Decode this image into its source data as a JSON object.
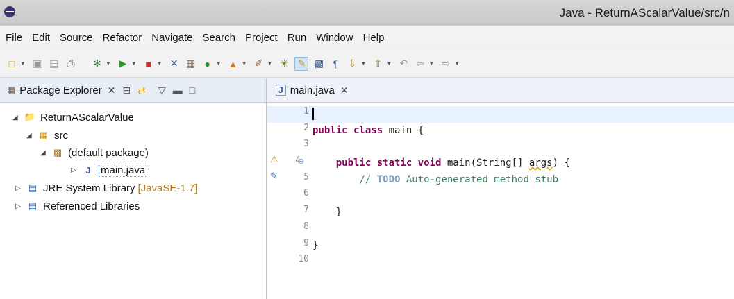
{
  "window": {
    "title": "Java - ReturnAScalarValue/src/n"
  },
  "menu": [
    "File",
    "Edit",
    "Source",
    "Refactor",
    "Navigate",
    "Search",
    "Project",
    "Run",
    "Window",
    "Help"
  ],
  "package_explorer": {
    "tab_label": "Package Explorer",
    "tree": {
      "project": "ReturnAScalarValue",
      "src": "src",
      "package": "(default package)",
      "file": "main.java",
      "jre_label": "JRE System Library",
      "jre_version": "[JavaSE-1.7]",
      "ref_libs": "Referenced Libraries"
    }
  },
  "editor": {
    "tab_label": "main.java",
    "line_numbers": [
      "1",
      "2",
      "3",
      "4",
      "5",
      "6",
      "7",
      "8",
      "9",
      "10"
    ],
    "code": {
      "l2_kw": "public class",
      "l2_rest": " main {",
      "l4_kw": "public static void",
      "l4_method": " main(String[] ",
      "l4_args": "args",
      "l4_end": ") {",
      "l5_prefix": "// ",
      "l5_todo": "TODO",
      "l5_rest": " Auto-generated method stub",
      "l7": "}",
      "l9": "}"
    }
  },
  "colors": {
    "keyword": "#7f0055",
    "comment": "#3f7f5f",
    "todo": "#7f9fbf",
    "current_line": "#e8f2fe"
  }
}
